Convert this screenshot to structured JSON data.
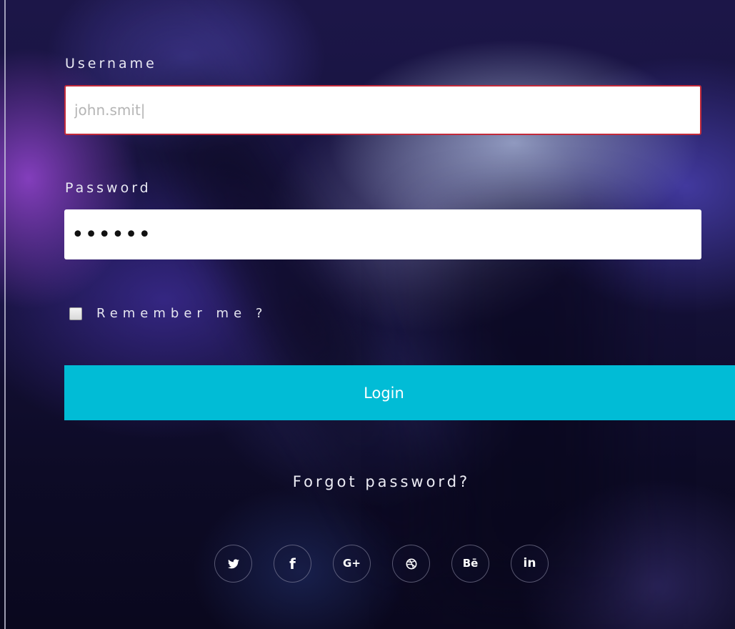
{
  "form": {
    "username_label": "Username",
    "username_value": "john.smit|",
    "password_label": "Password",
    "password_value": "••••••",
    "remember_label": "Remember me ?",
    "remember_checked": false,
    "login_label": "Login",
    "forgot_label": "Forgot password?"
  },
  "social": [
    {
      "icon": "twitter-icon",
      "glyph": "🐦"
    },
    {
      "icon": "facebook-icon",
      "glyph": "f"
    },
    {
      "icon": "google-plus-icon",
      "glyph": "G+"
    },
    {
      "icon": "dribbble-icon",
      "glyph": "⊛"
    },
    {
      "icon": "behance-icon",
      "glyph": "Bē"
    },
    {
      "icon": "linkedin-icon",
      "glyph": "in"
    }
  ],
  "colors": {
    "accent": "#01bcd6",
    "error_border": "#c22a3a",
    "label_text": "#e8e8f2",
    "input_placeholder": "#b5b5b5"
  }
}
